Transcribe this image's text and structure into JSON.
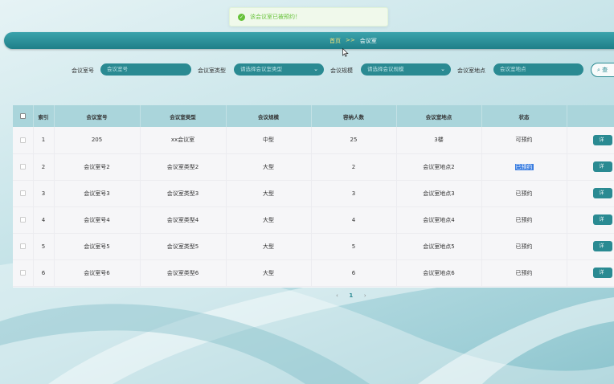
{
  "toast": {
    "message": "该会议室已被预约！"
  },
  "breadcrumb": {
    "home": "首页",
    "separator": ">>",
    "current": "会议室"
  },
  "filters": {
    "room_no_label": "会议室号",
    "room_no_placeholder": "会议室号",
    "room_type_label": "会议室类型",
    "room_type_placeholder": "请选择会议室类型",
    "scale_label": "会议规模",
    "scale_placeholder": "请选择会议规模",
    "location_label": "会议室地点",
    "location_placeholder": "会议室地点",
    "search_label": "查"
  },
  "table": {
    "headers": [
      "索引",
      "会议室号",
      "会议室类型",
      "会议规模",
      "容纳人数",
      "会议室地点",
      "状态"
    ],
    "rows": [
      {
        "index": "1",
        "room_no": "205",
        "room_type": "xx会议室",
        "scale": "中型",
        "capacity": "25",
        "location": "3楼",
        "status": "可预约"
      },
      {
        "index": "2",
        "room_no": "会议室号2",
        "room_type": "会议室类型2",
        "scale": "大型",
        "capacity": "2",
        "location": "会议室地点2",
        "status": "已预约"
      },
      {
        "index": "3",
        "room_no": "会议室号3",
        "room_type": "会议室类型3",
        "scale": "大型",
        "capacity": "3",
        "location": "会议室地点3",
        "status": "已预约"
      },
      {
        "index": "4",
        "room_no": "会议室号4",
        "room_type": "会议室类型4",
        "scale": "大型",
        "capacity": "4",
        "location": "会议室地点4",
        "status": "已预约"
      },
      {
        "index": "5",
        "room_no": "会议室号5",
        "room_type": "会议室类型5",
        "scale": "大型",
        "capacity": "5",
        "location": "会议室地点5",
        "status": "已预约"
      },
      {
        "index": "6",
        "room_no": "会议室号6",
        "room_type": "会议室类型6",
        "scale": "大型",
        "capacity": "6",
        "location": "会议室地点6",
        "status": "已预约"
      }
    ],
    "detail_label": "详"
  },
  "pager": {
    "prev": "‹",
    "page": "1",
    "next": "›"
  },
  "colors": {
    "accent": "#2a8a92",
    "header_bg": "#aad5db",
    "toast_green": "#67c23a",
    "breadcrumb_yellow": "#f2e27a"
  }
}
